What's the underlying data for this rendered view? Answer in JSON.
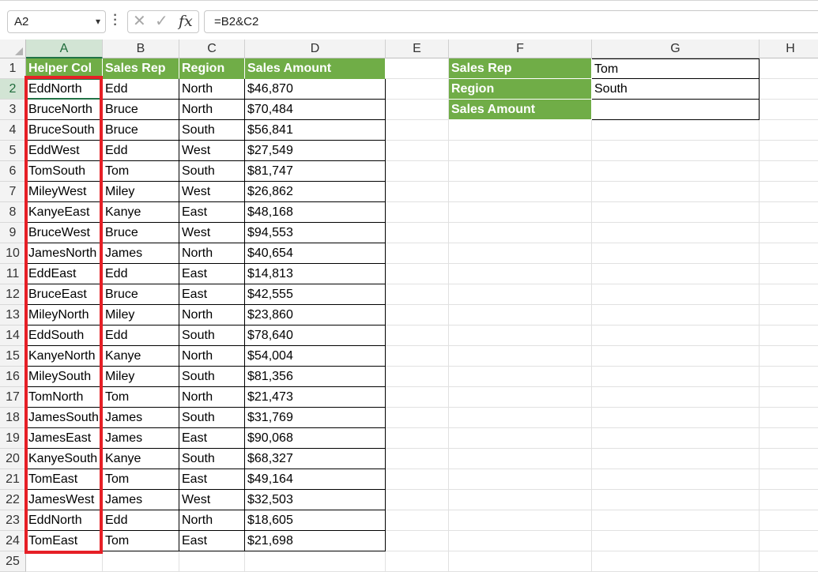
{
  "formula_bar": {
    "name_box": "A2",
    "cancel_icon": "✕",
    "enter_icon": "✓",
    "fx_label": "fx",
    "formula": "=B2&C2"
  },
  "columns": [
    "A",
    "B",
    "C",
    "D",
    "E",
    "F",
    "G",
    "H"
  ],
  "selected_column": "A",
  "selected_row": 2,
  "table": {
    "headers": [
      "Helper Col",
      "Sales Rep",
      "Region",
      "Sales Amount"
    ],
    "rows": [
      [
        "EddNorth",
        "Edd",
        "North",
        "$46,870"
      ],
      [
        "BruceNorth",
        "Bruce",
        "North",
        "$70,484"
      ],
      [
        "BruceSouth",
        "Bruce",
        "South",
        "$56,841"
      ],
      [
        "EddWest",
        "Edd",
        "West",
        "$27,549"
      ],
      [
        "TomSouth",
        "Tom",
        "South",
        "$81,747"
      ],
      [
        "MileyWest",
        "Miley",
        "West",
        "$26,862"
      ],
      [
        "KanyeEast",
        "Kanye",
        "East",
        "$48,168"
      ],
      [
        "BruceWest",
        "Bruce",
        "West",
        "$94,553"
      ],
      [
        "JamesNorth",
        "James",
        "North",
        "$40,654"
      ],
      [
        "EddEast",
        "Edd",
        "East",
        "$14,813"
      ],
      [
        "BruceEast",
        "Bruce",
        "East",
        "$42,555"
      ],
      [
        "MileyNorth",
        "Miley",
        "North",
        "$23,860"
      ],
      [
        "EddSouth",
        "Edd",
        "South",
        "$78,640"
      ],
      [
        "KanyeNorth",
        "Kanye",
        "North",
        "$54,004"
      ],
      [
        "MileySouth",
        "Miley",
        "South",
        "$81,356"
      ],
      [
        "TomNorth",
        "Tom",
        "North",
        "$21,473"
      ],
      [
        "JamesSouth",
        "James",
        "South",
        "$31,769"
      ],
      [
        "JamesEast",
        "James",
        "East",
        "$90,068"
      ],
      [
        "KanyeSouth",
        "Kanye",
        "South",
        "$68,327"
      ],
      [
        "TomEast",
        "Tom",
        "East",
        "$49,164"
      ],
      [
        "JamesWest",
        "James",
        "West",
        "$32,503"
      ],
      [
        "EddNorth",
        "Edd",
        "North",
        "$18,605"
      ],
      [
        "TomEast",
        "Tom",
        "East",
        "$21,698"
      ]
    ]
  },
  "lookup": [
    {
      "label": "Sales Rep",
      "value": "Tom"
    },
    {
      "label": "Region",
      "value": "South"
    },
    {
      "label": "Sales Amount",
      "value": ""
    }
  ],
  "colors": {
    "header_green": "#70ad47",
    "selection_red": "#e61f26",
    "excel_green": "#217346"
  }
}
